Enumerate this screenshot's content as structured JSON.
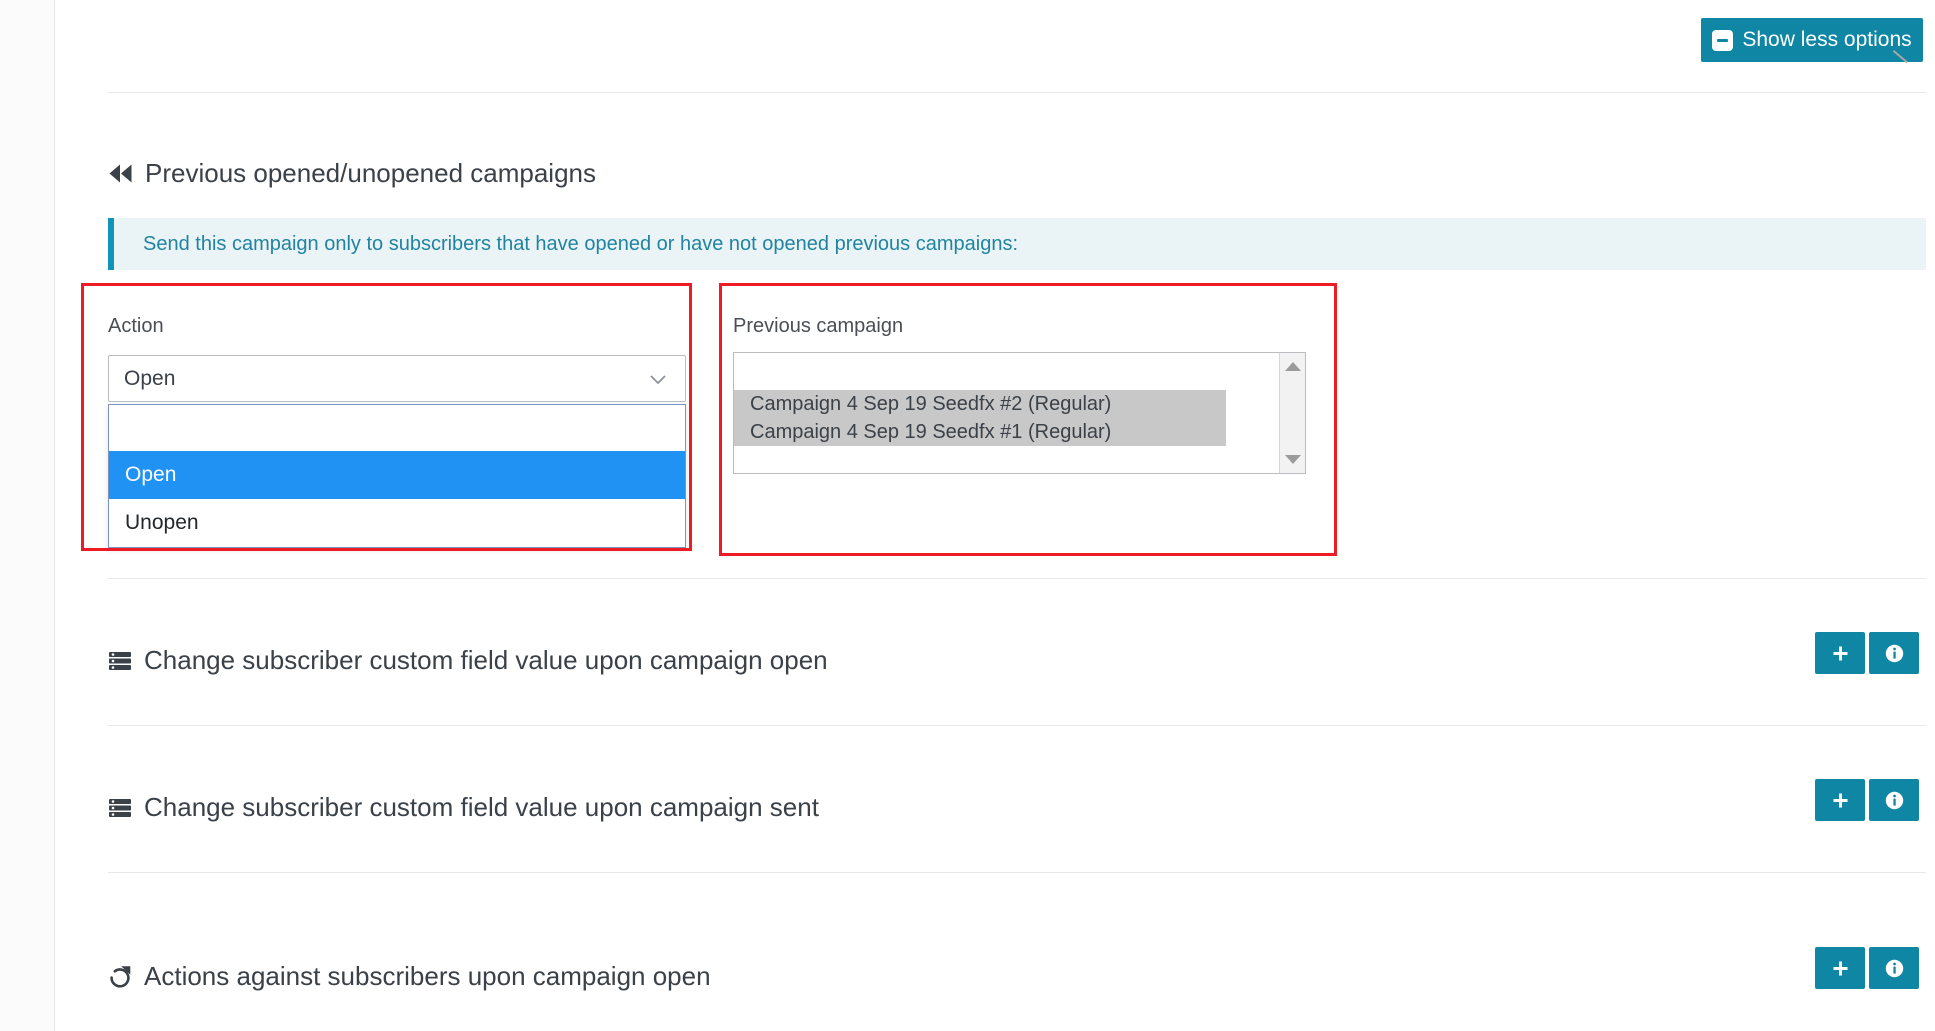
{
  "toolbar": {
    "show_less_label": "Show less options",
    "minus_icon": "minus-icon",
    "accent_color": "#0f86a3"
  },
  "section": {
    "title": "Previous opened/unopened campaigns",
    "icon": "fast-backward-icon",
    "banner_text": "Send this campaign only to subscribers that have opened or have not opened previous campaigns:",
    "banner_accent": "#0f95ba",
    "banner_bg": "#eaf4f6"
  },
  "action_field": {
    "label": "Action",
    "selected_value": "Open",
    "chevron_icon": "chevron-down-icon",
    "options": [
      {
        "label": "",
        "selected": false
      },
      {
        "label": "Open",
        "selected": true
      },
      {
        "label": "Unopen",
        "selected": false
      }
    ],
    "highlight_color": "#2092f4"
  },
  "previous_campaign": {
    "label": "Previous campaign",
    "options": [
      {
        "label": "Campaign 4 Sep 19 Seedfx #2 (Regular)",
        "selected": true
      },
      {
        "label": "Campaign 4 Sep 19 Seedfx #1 (Regular)",
        "selected": true
      }
    ],
    "scroll_up_icon": "scroll-up-arrow-icon",
    "scroll_down_icon": "scroll-down-arrow-icon",
    "resize_icon": "resize-grip-icon",
    "selected_bg": "#c8c8c8"
  },
  "annotations": [
    {
      "name": "action-highlight",
      "color": "#ed1c24"
    },
    {
      "name": "previous-campaign-highlight",
      "color": "#ed1c24"
    }
  ],
  "option_rows": [
    {
      "title": "Change subscriber custom field value upon campaign open",
      "icon": "server-stack-icon",
      "add_icon": "plus-icon",
      "info_icon": "info-icon"
    },
    {
      "title": "Change subscriber custom field value upon campaign sent",
      "icon": "server-stack-icon",
      "add_icon": "plus-icon",
      "info_icon": "info-icon"
    },
    {
      "title": "Actions against subscribers upon campaign open",
      "icon": "external-action-icon",
      "add_icon": "plus-icon",
      "info_icon": "info-icon"
    }
  ]
}
